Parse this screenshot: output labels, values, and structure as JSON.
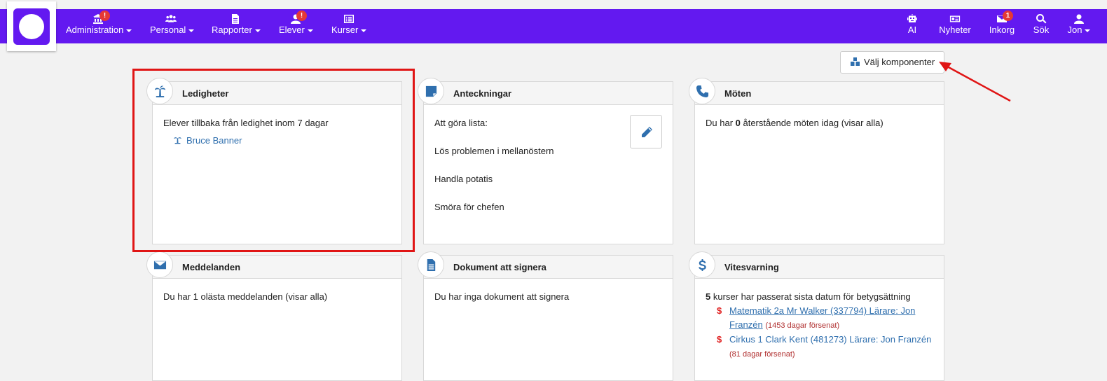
{
  "navbar": {
    "items": [
      {
        "label": "Administration",
        "badge": "!"
      },
      {
        "label": "Personal"
      },
      {
        "label": "Rapporter"
      },
      {
        "label": "Elever",
        "badge": "!"
      },
      {
        "label": "Kurser"
      }
    ],
    "right": [
      {
        "label": "AI"
      },
      {
        "label": "Nyheter"
      },
      {
        "label": "Inkorg",
        "badge": "1"
      },
      {
        "label": "Sök"
      },
      {
        "label": "Jon"
      }
    ]
  },
  "toolbar": {
    "choose_components_label": "Välj komponenter"
  },
  "cards": {
    "ledigheter": {
      "title": "Ledigheter",
      "text": "Elever tillbaka från ledighet inom 7 dagar",
      "student": "Bruce Banner"
    },
    "anteckningar": {
      "title": "Anteckningar",
      "lines": [
        "Att göra lista:",
        "Lös problemen i mellanöstern",
        "Handla potatis",
        "Smöra för chefen"
      ]
    },
    "moten": {
      "title": "Möten",
      "prefix": "Du har ",
      "count": "0",
      "suffix": " återstående möten idag ",
      "link": "(visar alla)"
    },
    "meddelanden": {
      "title": "Meddelanden",
      "text": "Du har 1 olästa meddelanden (visar alla)"
    },
    "dokument": {
      "title": "Dokument att signera",
      "text": "Du har inga dokument att signera"
    },
    "vitesvarning": {
      "title": "Vitesvarning",
      "count": "5",
      "text": " kurser har passerat sista datum för betygsättning",
      "items": [
        {
          "line1": "Matematik 2a Mr Walker (337794) Lärare: Jon",
          "line2": "Franzén",
          "late": "(1453 dagar försenat)"
        },
        {
          "line1": "Cirkus 1 Clark Kent (481273) Lärare: Jon Franzén",
          "late": "(81 dagar försenat)"
        }
      ]
    }
  },
  "colors": {
    "navbar": "#6319f0",
    "accent": "#2f6fae",
    "badge": "#e53935",
    "highlight": "#e01515"
  }
}
